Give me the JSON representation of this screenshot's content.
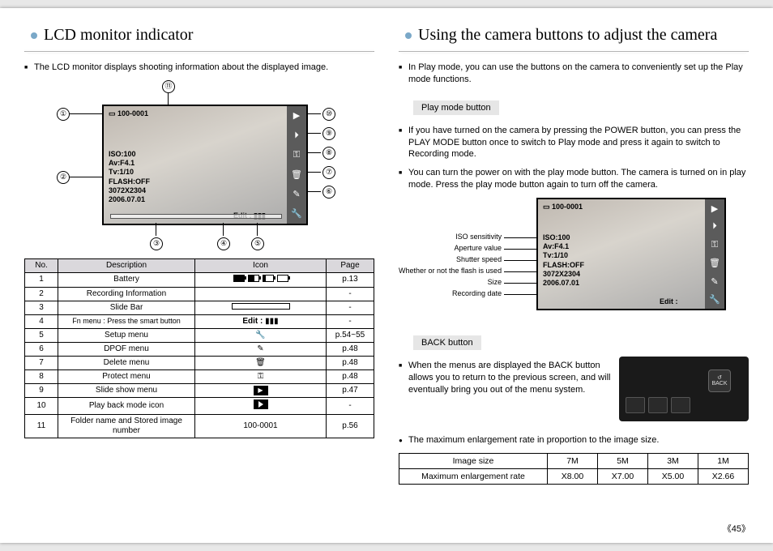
{
  "left": {
    "title": "LCD monitor indicator",
    "intro": "The LCD monitor displays shooting information about the displayed image.",
    "lcd": {
      "folder": "100-0001",
      "iso": "ISO:100",
      "av": "Av:F4.1",
      "tv": "Tv:1/10",
      "flash": "FLASH:OFF",
      "size": "3072X2304",
      "date": "2006.07.01",
      "edit": "Edit :"
    },
    "callouts": {
      "c1": "①",
      "c2": "②",
      "c3": "③",
      "c4": "④",
      "c5": "⑤",
      "c6": "⑥",
      "c7": "⑦",
      "c8": "⑧",
      "c9": "⑨",
      "c10": "⑩",
      "c11": "⑪"
    },
    "table": {
      "headers": {
        "no": "No.",
        "desc": "Description",
        "icon": "Icon",
        "page": "Page"
      },
      "rows": [
        {
          "no": "1",
          "desc": "Battery",
          "icon": "battery",
          "page": "p.13"
        },
        {
          "no": "2",
          "desc": "Recording Information",
          "icon": "-",
          "page": "-"
        },
        {
          "no": "3",
          "desc": "Slide Bar",
          "icon": "slidebar",
          "page": "-"
        },
        {
          "no": "4",
          "desc": "Fn menu : Press the smart button",
          "icon": "edit",
          "page": "-",
          "edit_label": "Edit :"
        },
        {
          "no": "5",
          "desc": "Setup menu",
          "icon": "wrench",
          "page": "p.54~55"
        },
        {
          "no": "6",
          "desc": "DPOF menu",
          "icon": "dpof",
          "page": "p.48"
        },
        {
          "no": "7",
          "desc": "Delete menu",
          "icon": "trash",
          "page": "p.48"
        },
        {
          "no": "8",
          "desc": "Protect menu",
          "icon": "key",
          "page": "p.48"
        },
        {
          "no": "9",
          "desc": "Slide show menu",
          "icon": "slideshow",
          "page": "p.47"
        },
        {
          "no": "10",
          "desc": "Play back mode icon",
          "icon": "play",
          "page": "-"
        },
        {
          "no": "11",
          "desc": "Folder name and Stored image number",
          "icon": "text",
          "text": "100-0001",
          "page": "p.56"
        }
      ]
    }
  },
  "right": {
    "title": "Using the camera buttons to adjust the camera",
    "intro": "In Play mode, you can use the buttons on the camera to conveniently set up the Play mode functions.",
    "sub1": "Play mode button",
    "p1": "If you have turned on the camera by pressing the POWER button, you can press the PLAY MODE button once to switch to Play mode and press it again to switch to Recording mode.",
    "p2": "You can turn the power on with the play mode button. The camera is turned on in play mode. Press the play mode button again to turn off the camera.",
    "labels": {
      "iso": "ISO sensitivity",
      "av": "Aperture value",
      "tv": "Shutter speed",
      "flash": "Whether or not the flash is used",
      "size": "Size",
      "date": "Recording date"
    },
    "sub2": "BACK button",
    "back_text": "When the menus are displayed the BACK button allows you to return to the previous screen, and will eventually bring you out of the menu system.",
    "back_label": "BACK",
    "enlarge_intro": "The maximum enlargement rate in proportion to the image size.",
    "enlarge": {
      "h1": "Image size",
      "h2": "Maximum enlargement rate",
      "sizes": [
        "7M",
        "5M",
        "3M",
        "1M"
      ],
      "rates": [
        "X8.00",
        "X7.00",
        "X5.00",
        "X2.66"
      ]
    }
  },
  "page_number": "45"
}
